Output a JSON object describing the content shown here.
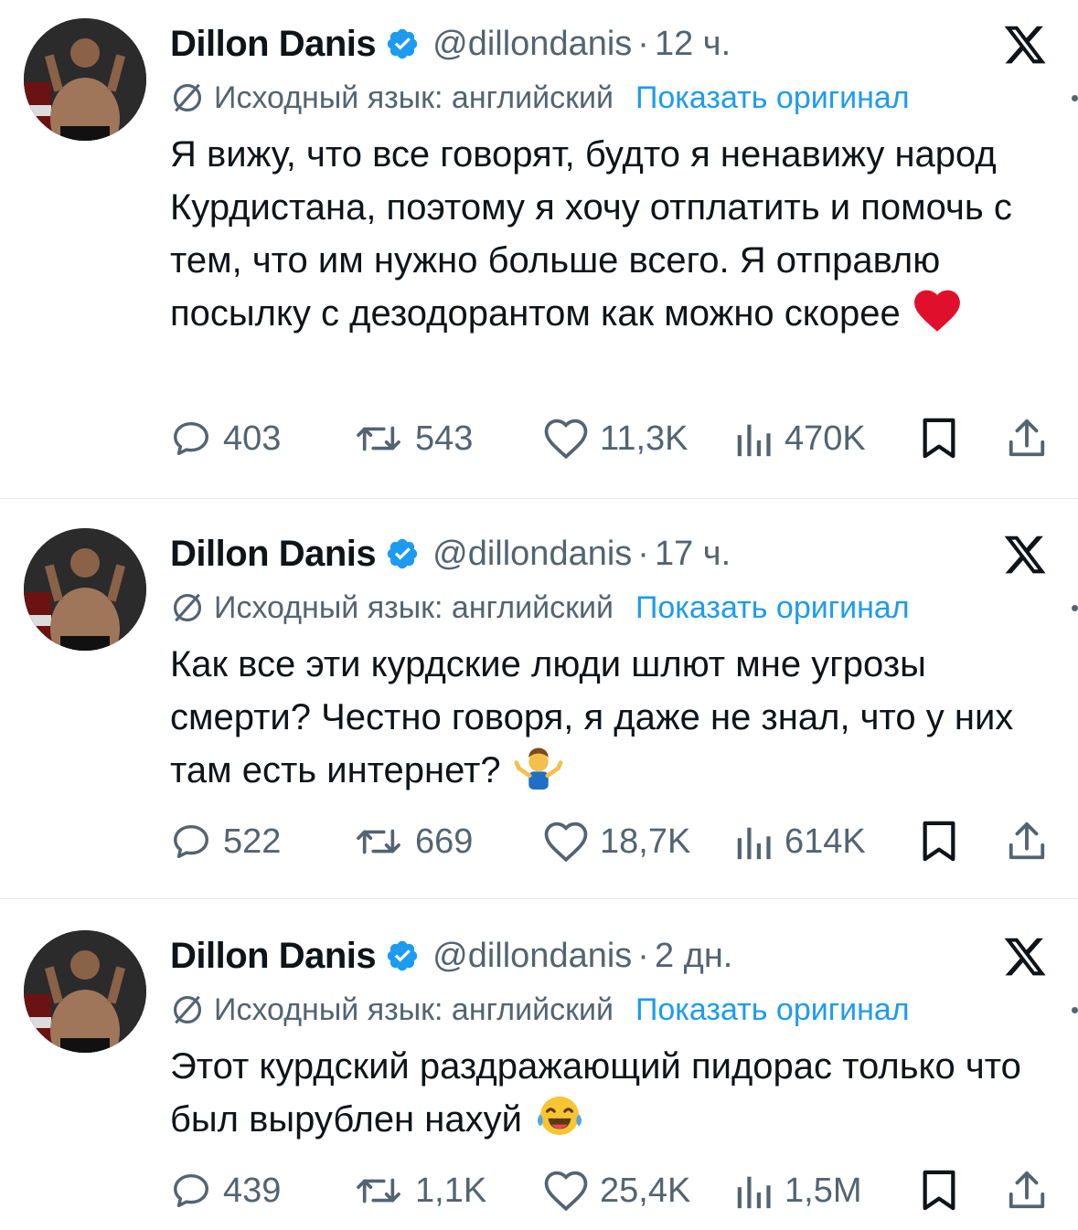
{
  "tweets": [
    {
      "author": {
        "name": "Dillon Danis",
        "handle": "@dillondanis"
      },
      "time": "12 ч.",
      "translation": {
        "source": "Исходный язык: английский",
        "action": "Показать оригинал"
      },
      "text": "Я вижу, что все говорят, будто я ненавижу народ Курдистана, поэтому я хочу отплатить и помочь с тем, что им нужно больше всего. Я отправлю посылку с дезодорантом как можно скорее",
      "emoji": "heart-emoji",
      "stats": {
        "replies": "403",
        "reposts": "543",
        "likes": "11,3K",
        "views": "470K"
      }
    },
    {
      "author": {
        "name": "Dillon Danis",
        "handle": "@dillondanis"
      },
      "time": "17 ч.",
      "translation": {
        "source": "Исходный язык: английский",
        "action": "Показать оригинал"
      },
      "text": "Как все эти курдские люди шлют мне угрозы смерти? Честно говоря, я даже не знал, что у них там есть интернет?",
      "emoji": "man-shrugging-emoji",
      "stats": {
        "replies": "522",
        "reposts": "669",
        "likes": "18,7K",
        "views": "614K"
      }
    },
    {
      "author": {
        "name": "Dillon Danis",
        "handle": "@dillondanis"
      },
      "time": "2 дн.",
      "translation": {
        "source": "Исходный язык: английский",
        "action": "Показать оригинал"
      },
      "text": "Этот курдский раздражающий пидорас только что был вырублен нахуй",
      "emoji": "tears-of-joy-emoji",
      "stats": {
        "replies": "439",
        "reposts": "1,1K",
        "likes": "25,4K",
        "views": "1,5M"
      }
    }
  ],
  "colors": {
    "text": "#0f1419",
    "secondary": "#536471",
    "link": "#1d9bf0",
    "verified": "#1d9bf0",
    "divider": "#e6e6e6"
  }
}
